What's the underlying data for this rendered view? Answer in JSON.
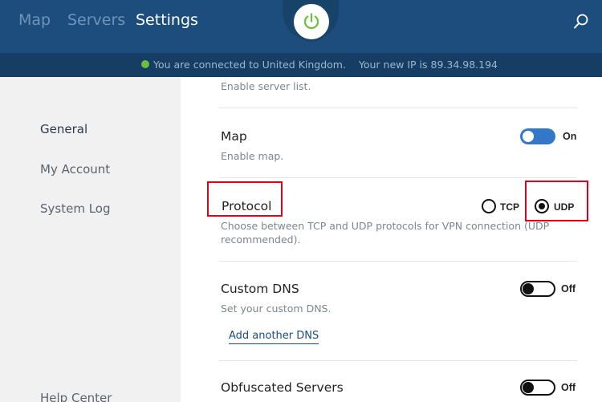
{
  "nav": {
    "tabs": [
      {
        "label": "Map"
      },
      {
        "label": "Servers"
      },
      {
        "label": "Settings"
      }
    ]
  },
  "status": {
    "connected_text": "You are connected to United Kingdom.",
    "ip_text": "Your new IP is 89.34.98.194",
    "dot_color": "#6bc13c"
  },
  "sidebar": {
    "items": [
      {
        "label": "General"
      },
      {
        "label": "My Account"
      },
      {
        "label": "System Log"
      },
      {
        "label": "Help Center"
      }
    ]
  },
  "settings": {
    "server_list": {
      "desc": "Enable server list."
    },
    "map": {
      "title": "Map",
      "desc": "Enable map.",
      "state": "On"
    },
    "protocol": {
      "title": "Protocol",
      "desc_line1": "Choose between TCP and UDP protocols for VPN connection (UDP",
      "desc_line2": "recommended).",
      "options": [
        "TCP",
        "UDP"
      ],
      "selected": "UDP"
    },
    "custom_dns": {
      "title": "Custom DNS",
      "desc": "Set your custom DNS.",
      "state": "Off",
      "add_link": "Add another DNS"
    },
    "obfuscated": {
      "title": "Obfuscated Servers",
      "state": "Off"
    }
  },
  "colors": {
    "nav_bg": "#1c4d7c",
    "accent": "#3377c9",
    "highlight": "#e0001b",
    "power_icon": "#6bc13c"
  }
}
